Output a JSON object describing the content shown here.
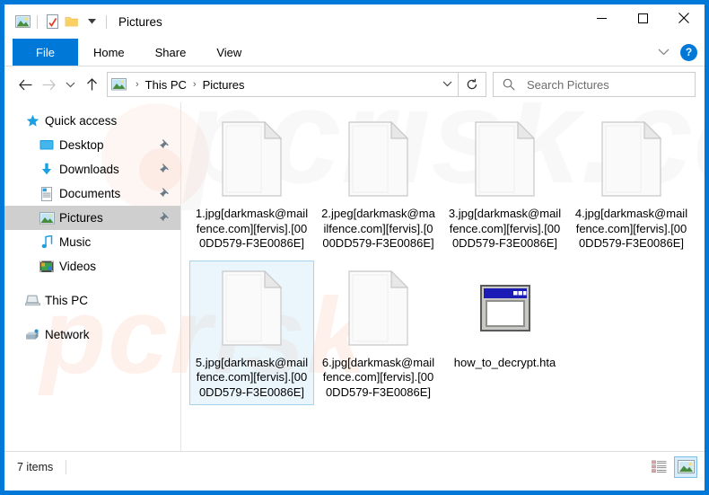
{
  "window": {
    "title": "Pictures",
    "accent_color": "#0078d7",
    "border_color": "#0078d7"
  },
  "titlebar": {
    "quick_access": [
      {
        "name": "pictures-folder-icon",
        "label": "Pictures"
      },
      {
        "name": "properties-icon",
        "label": "Properties"
      },
      {
        "name": "new-folder-icon",
        "label": "New folder"
      },
      {
        "name": "customize-quick-access-icon",
        "label": "Customize Quick Access Toolbar"
      }
    ],
    "minimize": "–",
    "maximize": "☐",
    "close": "✕"
  },
  "ribbon": {
    "tabs": [
      {
        "label": "File",
        "active": true
      },
      {
        "label": "Home",
        "active": false
      },
      {
        "label": "Share",
        "active": false
      },
      {
        "label": "View",
        "active": false
      }
    ],
    "expand_label": "⌄",
    "help_label": "?"
  },
  "addressbar": {
    "back": "←",
    "forward": "→",
    "recent": "⌄",
    "up": "↑",
    "breadcrumbs": [
      {
        "label": "This PC"
      },
      {
        "label": "Pictures"
      }
    ],
    "separator": "›",
    "dropdown": "⌄",
    "refresh": "↻"
  },
  "search": {
    "placeholder": "Search Pictures",
    "icon": "search-icon"
  },
  "sidebar": {
    "groups": [
      {
        "items": [
          {
            "label": "Quick access",
            "icon": "star-icon",
            "level": 0,
            "pinned": false,
            "selected": false
          },
          {
            "label": "Desktop",
            "icon": "desktop-icon",
            "level": 1,
            "pinned": true,
            "selected": false
          },
          {
            "label": "Downloads",
            "icon": "downloads-icon",
            "level": 1,
            "pinned": true,
            "selected": false
          },
          {
            "label": "Documents",
            "icon": "documents-icon",
            "level": 1,
            "pinned": true,
            "selected": false
          },
          {
            "label": "Pictures",
            "icon": "pictures-icon",
            "level": 1,
            "pinned": true,
            "selected": true
          },
          {
            "label": "Music",
            "icon": "music-icon",
            "level": 1,
            "pinned": false,
            "selected": false
          },
          {
            "label": "Videos",
            "icon": "videos-icon",
            "level": 1,
            "pinned": false,
            "selected": false
          }
        ]
      },
      {
        "items": [
          {
            "label": "This PC",
            "icon": "this-pc-icon",
            "level": 0,
            "pinned": false,
            "selected": false
          }
        ]
      },
      {
        "items": [
          {
            "label": "Network",
            "icon": "network-icon",
            "level": 0,
            "pinned": false,
            "selected": false
          }
        ]
      }
    ]
  },
  "files": [
    {
      "name": "1.jpg[darkmask@mailfence.com][fervis].[000DD579-F3E0086E]",
      "icon": "generic-file-icon",
      "selected": false
    },
    {
      "name": "2.jpeg[darkmask@mailfence.com][fervis].[000DD579-F3E0086E]",
      "icon": "generic-file-icon",
      "selected": false
    },
    {
      "name": "3.jpg[darkmask@mailfence.com][fervis].[000DD579-F3E0086E]",
      "icon": "generic-file-icon",
      "selected": false
    },
    {
      "name": "4.jpg[darkmask@mailfence.com][fervis].[000DD579-F3E0086E]",
      "icon": "generic-file-icon",
      "selected": false
    },
    {
      "name": "5.jpg[darkmask@mailfence.com][fervis].[000DD579-F3E0086E]",
      "icon": "generic-file-icon",
      "selected": true
    },
    {
      "name": "6.jpg[darkmask@mailfence.com][fervis].[000DD579-F3E0086E]",
      "icon": "generic-file-icon",
      "selected": false
    },
    {
      "name": "how_to_decrypt.hta",
      "icon": "hta-window-icon",
      "selected": false
    }
  ],
  "statusbar": {
    "item_count": "7 items",
    "views": [
      {
        "name": "details-view-button",
        "active": false
      },
      {
        "name": "large-icons-view-button",
        "active": true
      }
    ]
  },
  "watermark": {
    "text_front": "pcrisk",
    "text_back": "pcrisk.com"
  }
}
